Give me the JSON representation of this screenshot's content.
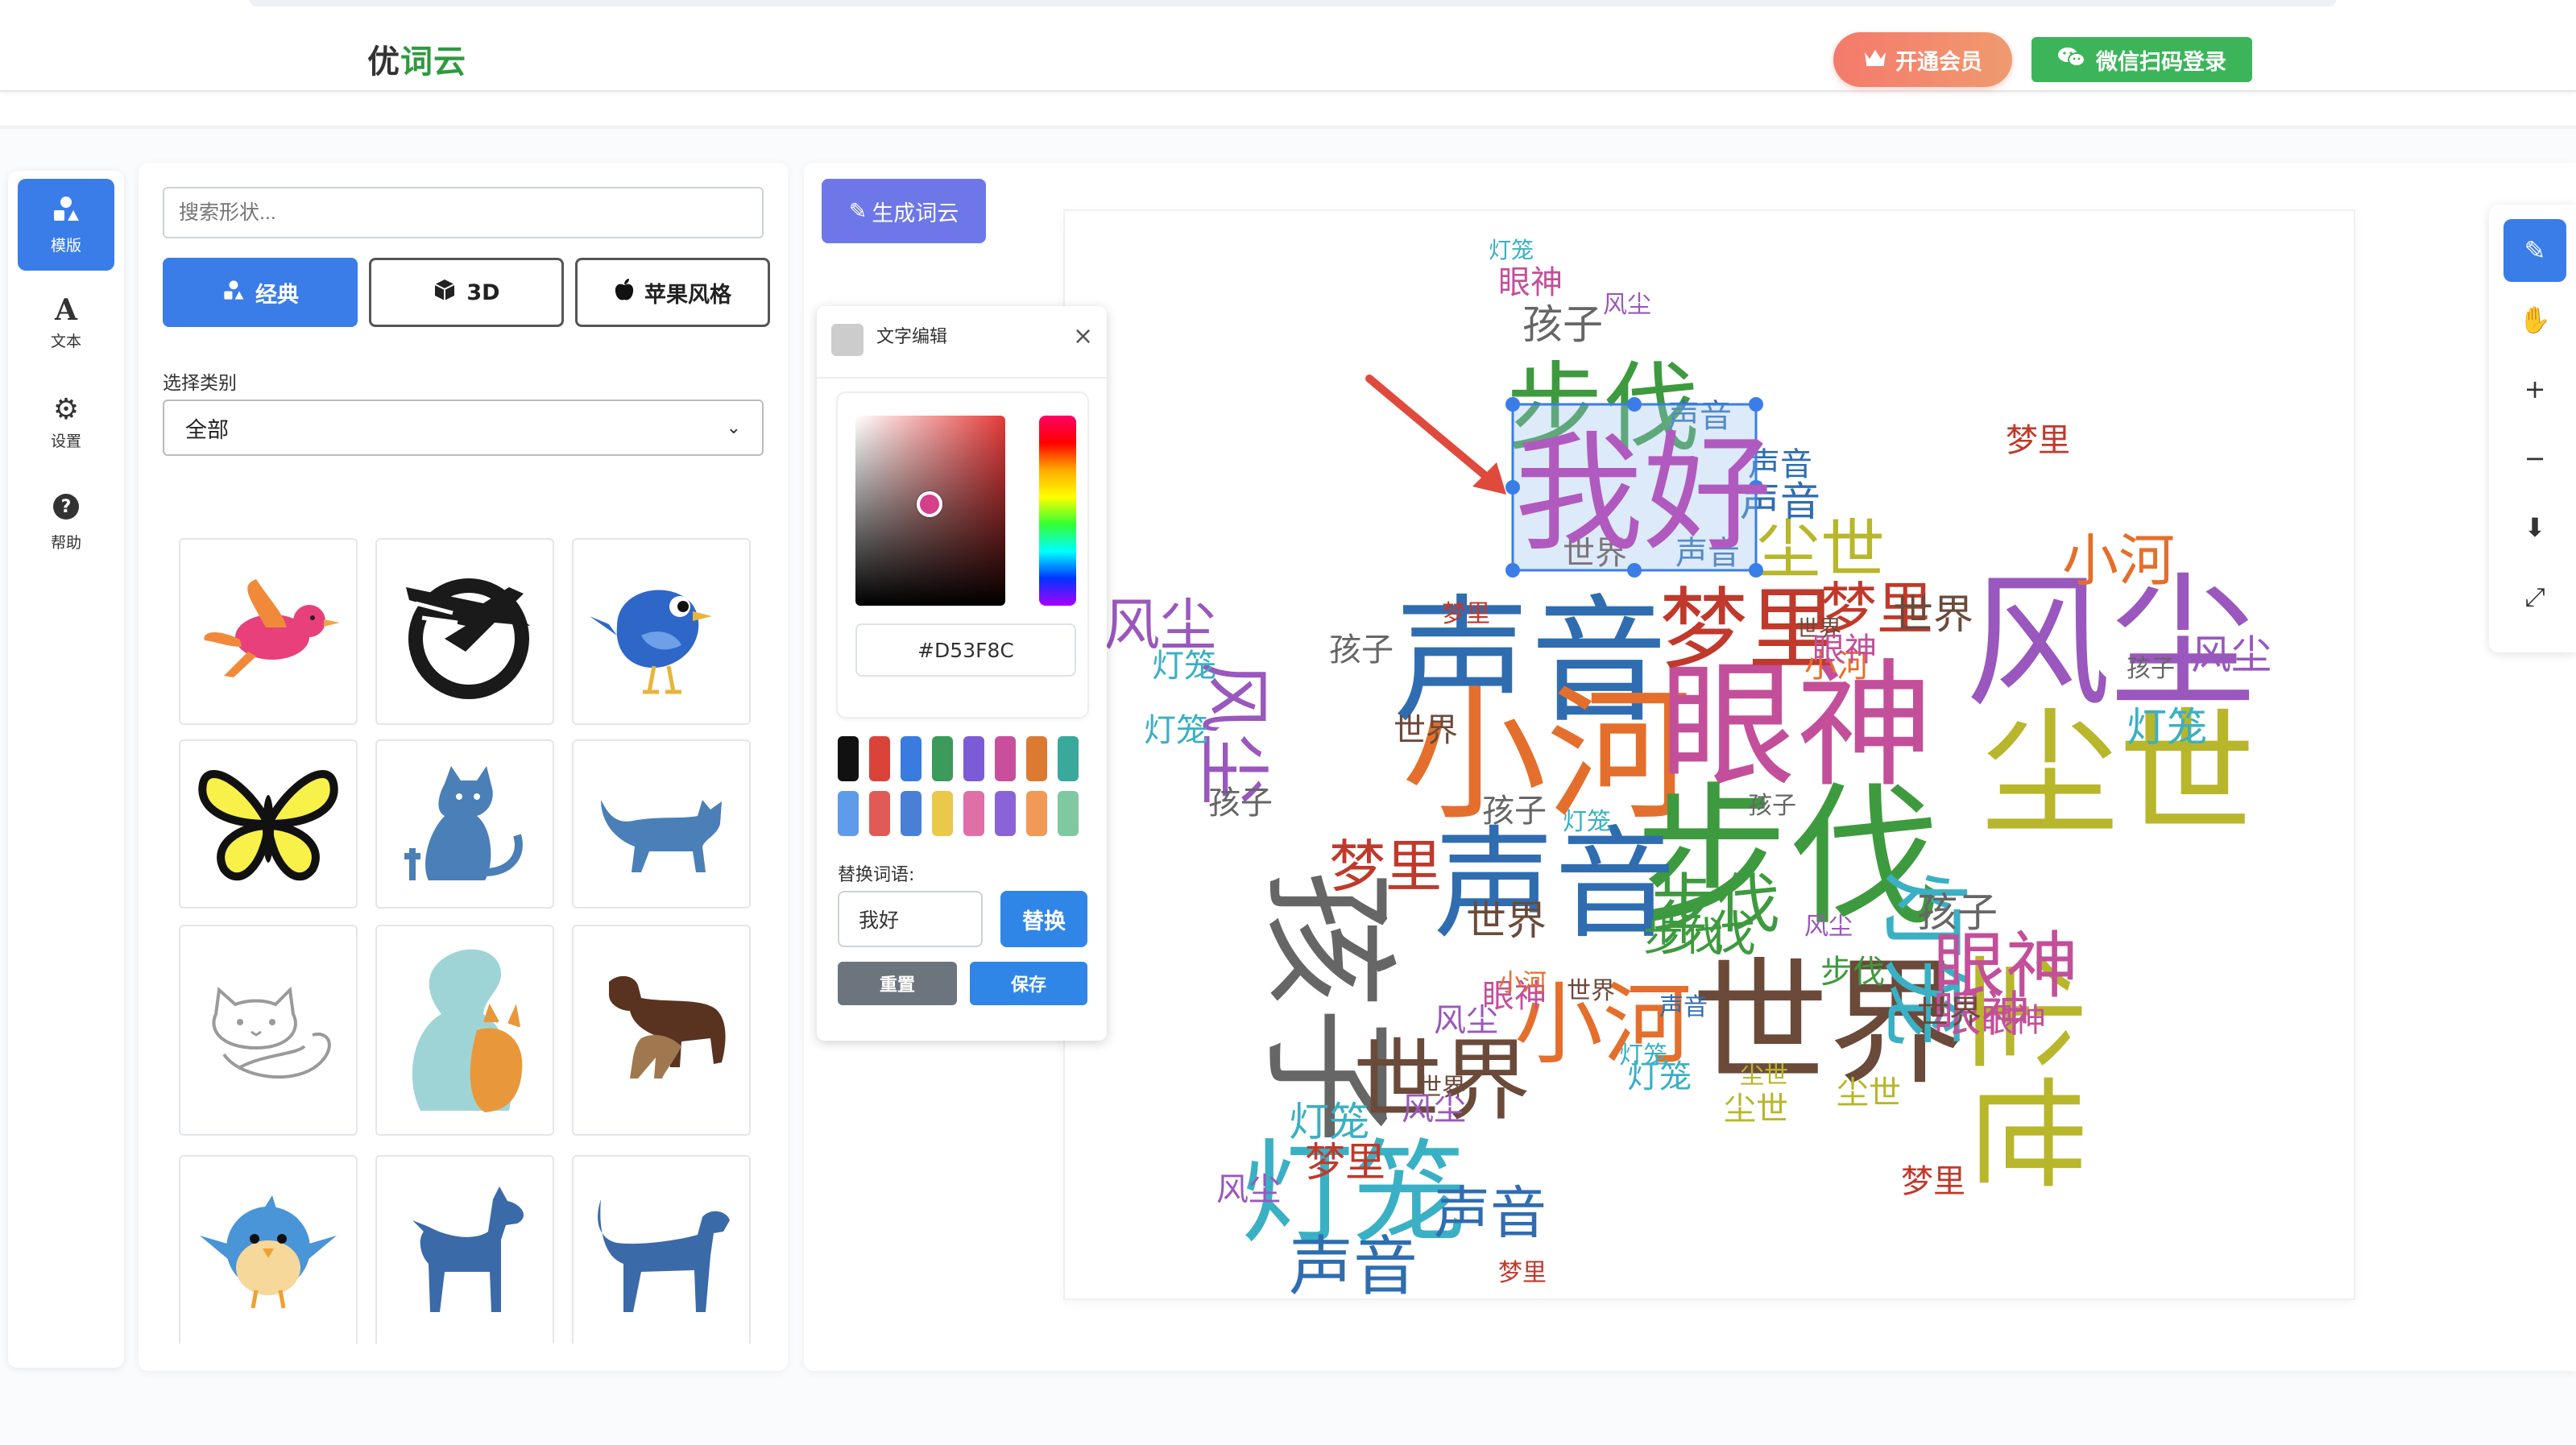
{
  "app": {
    "logo_part1": "优",
    "logo_part2": "词云",
    "vip_button": "开通会员",
    "wechat_login": "微信扫码登录"
  },
  "nav": [
    {
      "label": "模版",
      "icon": "shapes-icon"
    },
    {
      "label": "文本",
      "icon": "text-icon"
    },
    {
      "label": "设置",
      "icon": "gear-icon"
    },
    {
      "label": "帮助",
      "icon": "help-icon"
    }
  ],
  "shapes_panel": {
    "search_placeholder": "搜索形状...",
    "tabs": [
      {
        "label": "经典",
        "icon": "shapes-icon",
        "active": true
      },
      {
        "label": "3D",
        "icon": "cube-icon",
        "active": false
      },
      {
        "label": "苹果风格",
        "icon": "apple-icon",
        "active": false
      }
    ],
    "category_label": "选择类别",
    "category_value": "全部",
    "shapes": [
      "bird-pink",
      "eagle-emblem",
      "blue-bird",
      "butterfly",
      "cat-sitting",
      "cat-walking",
      "cats-outline",
      "dog-and-cat",
      "dogs",
      "round-bird",
      "dog-standing",
      "dog-walking"
    ]
  },
  "canvas": {
    "generate_button": "生成词云",
    "selected_word": "我好"
  },
  "editor": {
    "title": "文字编辑",
    "close": "×",
    "hex_value": "#D53F8C",
    "swatches_row1": [
      "#111111",
      "#d9433a",
      "#3a7be0",
      "#3c9a5a",
      "#7c5cd6",
      "#c94f9c",
      "#dd7a32",
      "#3aa89a"
    ],
    "swatches_row2": [
      "#5e9be8",
      "#e05a57",
      "#4a7fd6",
      "#e9c84a",
      "#e06fa8",
      "#8a63d8",
      "#f09a56",
      "#7fc8a0"
    ],
    "replace_label": "替换词语:",
    "replace_value": "我好",
    "replace_button": "替换",
    "reset_button": "重置",
    "save_button": "保存"
  },
  "toolbar": [
    "edit-icon",
    "hand-icon",
    "zoom-in-icon",
    "zoom-out-icon",
    "download-icon",
    "fullscreen-icon"
  ],
  "words": [
    {
      "t": "我好",
      "c": "#b05abf"
    },
    {
      "t": "声音",
      "c": "#2f6db0"
    },
    {
      "t": "小河",
      "c": "#e46f2c"
    },
    {
      "t": "眼神",
      "c": "#c34f9a"
    },
    {
      "t": "步伐",
      "c": "#3e9a3e"
    },
    {
      "t": "风尘",
      "c": "#9a57bd"
    },
    {
      "t": "尘世",
      "c": "#b8b62a"
    },
    {
      "t": "孩子",
      "c": "#666666"
    },
    {
      "t": "梦里",
      "c": "#c0392b"
    },
    {
      "t": "世界",
      "c": "#6b4a3a"
    },
    {
      "t": "灯笼",
      "c": "#3ab0c4"
    }
  ]
}
